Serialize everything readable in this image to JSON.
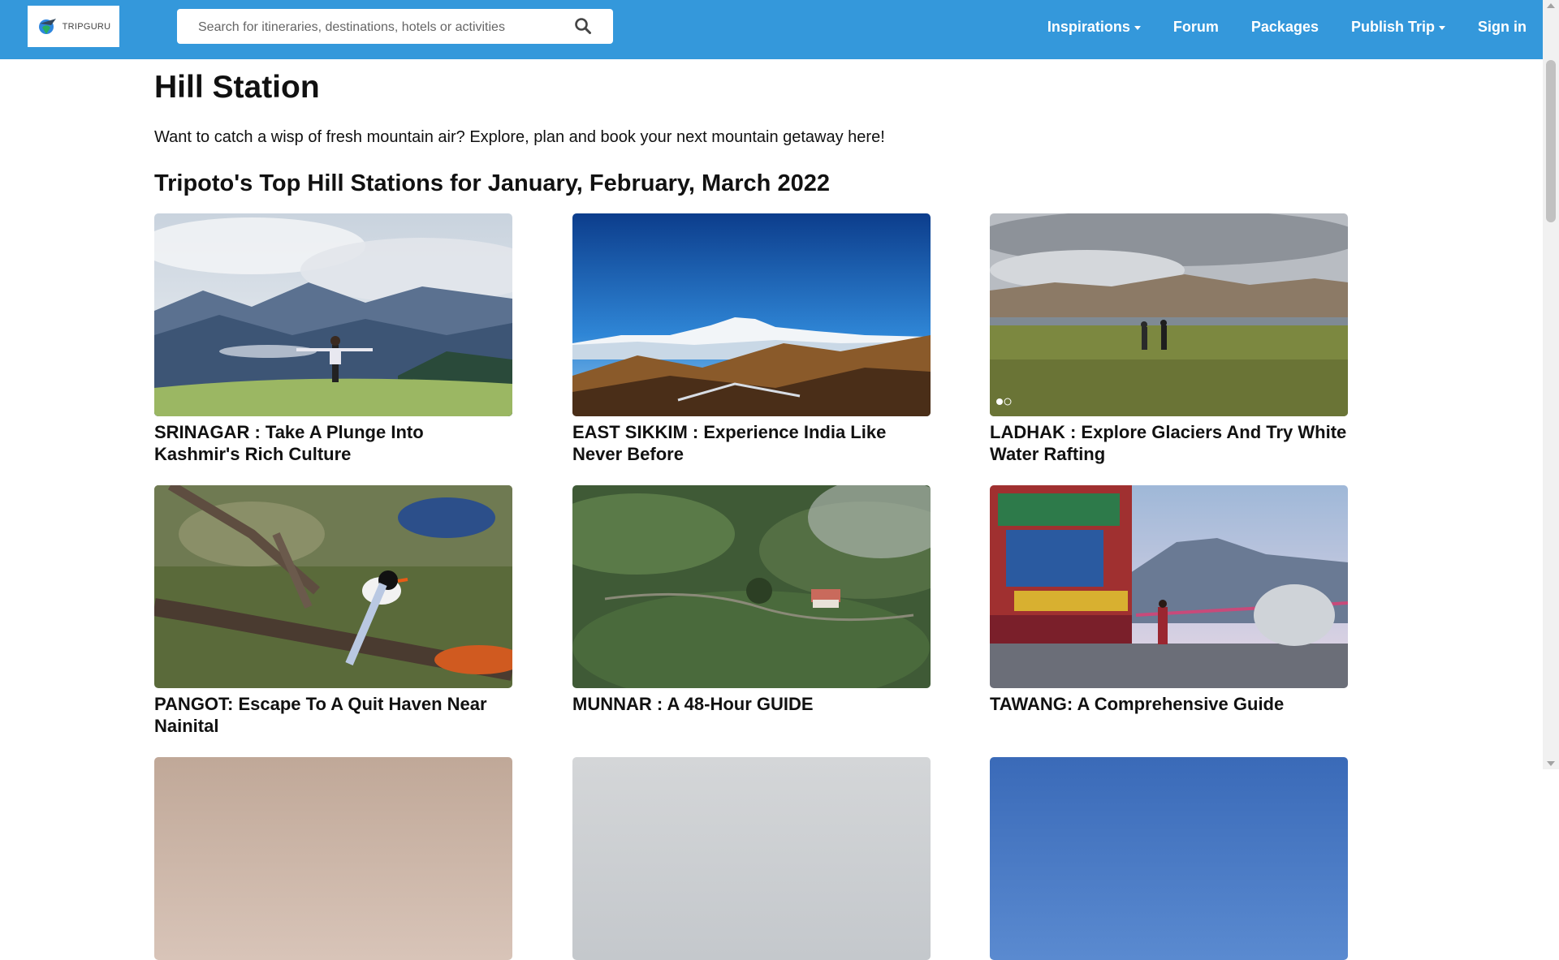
{
  "brand": {
    "name": "TRIPGURU",
    "accent_color": "#3498db"
  },
  "search": {
    "placeholder": "Search for itineraries, destinations, hotels or activities",
    "value": ""
  },
  "nav": {
    "items": [
      {
        "label": "Inspirations",
        "dropdown": true
      },
      {
        "label": "Forum",
        "dropdown": false
      },
      {
        "label": "Packages",
        "dropdown": false
      },
      {
        "label": "Publish Trip",
        "dropdown": true
      },
      {
        "label": "Sign in",
        "dropdown": false
      }
    ]
  },
  "page": {
    "title": "Hill Station",
    "intro": "Want to catch a wisp of fresh mountain air? Explore, plan and book your next mountain getaway here!",
    "section_title": "Tripoto's Top Hill Stations for January, February, March 2022"
  },
  "cards": [
    {
      "title": "SRINAGAR : Take A Plunge Into Kashmir's Rich Culture",
      "scene": "mountain-meadow-person"
    },
    {
      "title": "EAST SIKKIM : Experience India Like Never Before",
      "scene": "snow-peak-blue-sky"
    },
    {
      "title": "LADHAK : Explore Glaciers And Try White Water Rafting",
      "scene": "grassland-lake-walkers"
    },
    {
      "title": "PANGOT: Escape To A Quit Haven Near Nainital",
      "scene": "bird-on-branch"
    },
    {
      "title": "MUNNAR : A 48-Hour GUIDE",
      "scene": "tea-plantation"
    },
    {
      "title": "TAWANG: A Comprehensive Guide",
      "scene": "monastery-courtyard"
    }
  ]
}
